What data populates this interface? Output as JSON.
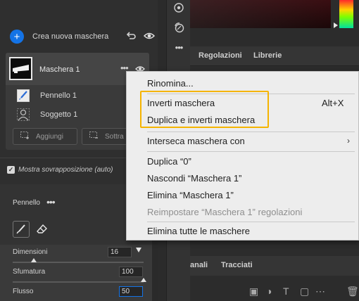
{
  "masks_panel": {
    "create_label": "Crea nuova maschera",
    "mask": {
      "name": "Maschera 1",
      "components": [
        {
          "label": "Pennello 1",
          "icon": "brush-icon"
        },
        {
          "label": "Soggetto 1",
          "icon": "person-icon"
        }
      ],
      "buttons": [
        {
          "label": "Aggiungi",
          "icon": "add-icon"
        },
        {
          "label": "Sottra",
          "icon": "subtract-icon"
        }
      ]
    },
    "overlay_label": "Mostra sovrapposizione (auto)",
    "overlay_checked": true
  },
  "brush_panel": {
    "title": "Pennello",
    "params": [
      {
        "label": "Dimensioni",
        "value": "16",
        "slider_fraction": 0.16
      },
      {
        "label": "Sfumatura",
        "value": "100",
        "slider_fraction": 1.0
      },
      {
        "label": "Flusso",
        "value": "50",
        "slider_fraction": 0.5
      }
    ]
  },
  "right_panel": {
    "tabs_top": [
      "Regolazioni",
      "Librerie"
    ],
    "tabs_bottom": [
      "anali",
      "Tracciati"
    ]
  },
  "context_menu": {
    "items": [
      {
        "label": "Rinomina..."
      },
      {
        "label": "Inverti maschera",
        "shortcut": "Alt+X"
      },
      {
        "label": "Duplica e inverti maschera"
      },
      {
        "label": "Interseca maschera con",
        "submenu": true
      },
      {
        "label": "Duplica “0”"
      },
      {
        "label": "Nascondi “Maschera 1”"
      },
      {
        "label": "Elimina “Maschera 1”"
      },
      {
        "label": "Reimpostare “Maschera 1” regolazioni",
        "disabled": true
      },
      {
        "label": "Elimina tutte le maschere"
      }
    ],
    "highlight_color": "#f5b400"
  },
  "colors": {
    "accent": "#1473e6",
    "menu_bg": "#ededed",
    "panel_bg": "#2f2f2f"
  }
}
